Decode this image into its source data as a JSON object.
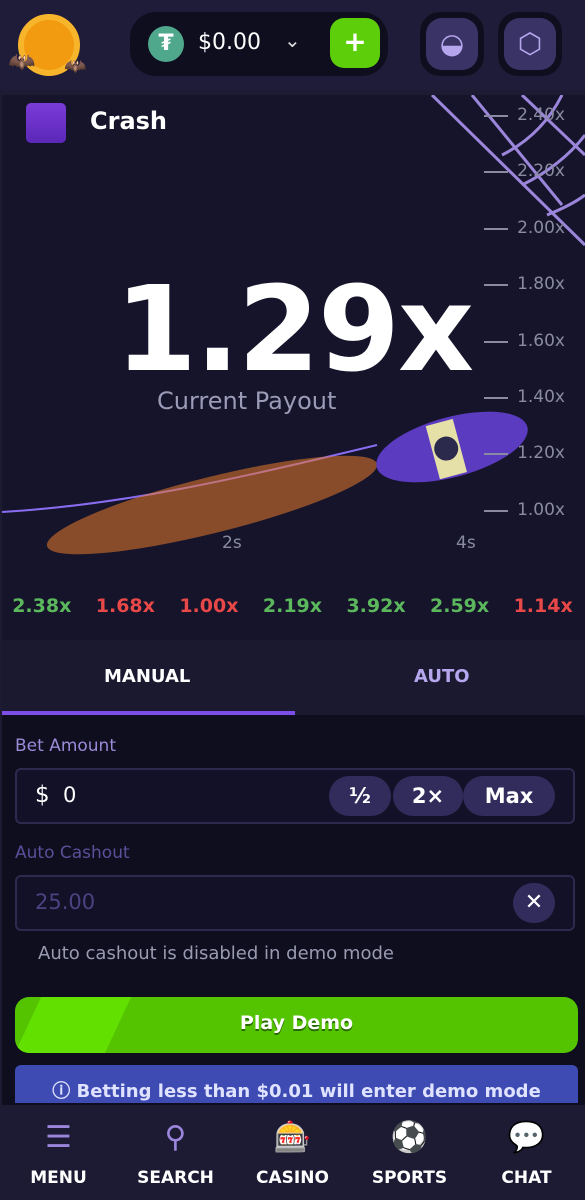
{
  "header": {
    "balance": "$0.00",
    "currency_icon": "tether-icon",
    "deposit_icon": "plus-icon",
    "buttons": [
      "cauldron-icon",
      "hexagon-icon"
    ]
  },
  "game": {
    "title": "Crash",
    "multiplier": "1.29x",
    "multiplier_caption": "Current Payout",
    "y_axis": [
      "2.40x",
      "2.20x",
      "2.00x",
      "1.80x",
      "1.60x",
      "1.40x",
      "1.20x",
      "1.00x"
    ],
    "x_axis": [
      "2s",
      "4s"
    ]
  },
  "history": [
    {
      "v": "2.38x",
      "c": "#5cb85c"
    },
    {
      "v": "1.68x",
      "c": "#e84848"
    },
    {
      "v": "1.00x",
      "c": "#e84848"
    },
    {
      "v": "2.19x",
      "c": "#5cb85c"
    },
    {
      "v": "3.92x",
      "c": "#5cb85c"
    },
    {
      "v": "2.59x",
      "c": "#5cb85c"
    },
    {
      "v": "1.14x",
      "c": "#e84848"
    }
  ],
  "tabs": {
    "manual": "MANUAL",
    "auto": "AUTO",
    "active": "manual"
  },
  "bet": {
    "label": "Bet Amount",
    "currency": "$",
    "value": "0",
    "half": "½",
    "double": "2×",
    "max": "Max"
  },
  "cashout": {
    "label": "Auto Cashout",
    "placeholder": "25.00",
    "note": "Auto cashout is disabled in demo mode"
  },
  "play_label": "Play Demo",
  "notice": "Betting less than $0.01 will enter demo mode",
  "nav": [
    {
      "label": "MENU",
      "icon": "menu-icon"
    },
    {
      "label": "SEARCH",
      "icon": "search-icon"
    },
    {
      "label": "CASINO",
      "icon": "slot-machine-icon"
    },
    {
      "label": "SPORTS",
      "icon": "soccer-ball-icon"
    },
    {
      "label": "CHAT",
      "icon": "chat-icon"
    }
  ],
  "colors": {
    "accent": "#7c4de8",
    "play": "#54c400",
    "win": "#5cb85c",
    "loss": "#e84848"
  }
}
